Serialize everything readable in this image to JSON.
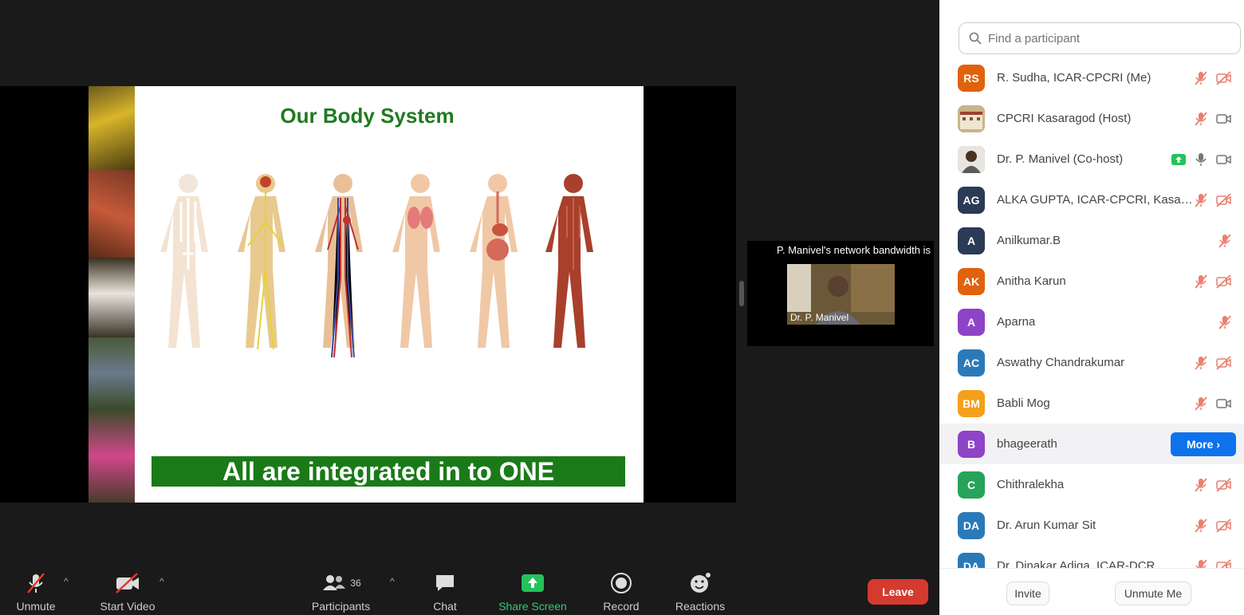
{
  "slide": {
    "title": "Our Body System",
    "banner": "All are integrated in to ONE"
  },
  "thumbnail": {
    "notice": "P. Manivel's network bandwidth is",
    "name": "Dr. P. Manivel"
  },
  "toolbar": {
    "unmute": "Unmute",
    "start_video": "Start Video",
    "participants": "Participants",
    "participant_count": "36",
    "chat": "Chat",
    "share_screen": "Share Screen",
    "record": "Record",
    "reactions": "Reactions",
    "leave": "Leave"
  },
  "panel": {
    "search_placeholder": "Find a participant",
    "invite": "Invite",
    "unmute_me": "Unmute Me",
    "more_label": "More",
    "participants": [
      {
        "initials": "RS",
        "color": "#e0620d",
        "name": "R. Sudha, ICAR-CPCRI (Me)"
      },
      {
        "initials": "",
        "color": "#8a6b3d",
        "name": "CPCRI Kasaragod (Host)"
      },
      {
        "initials": "",
        "color": "#5a4632",
        "name": "Dr. P. Manivel (Co-host)"
      },
      {
        "initials": "AG",
        "color": "#2b3a55",
        "name": "ALKA GUPTA, ICAR-CPCRI, Kasar..."
      },
      {
        "initials": "A",
        "color": "#2b3a55",
        "name": "Anilkumar.B"
      },
      {
        "initials": "AK",
        "color": "#e0620d",
        "name": "Anitha Karun"
      },
      {
        "initials": "A",
        "color": "#8e44c6",
        "name": "Aparna"
      },
      {
        "initials": "AC",
        "color": "#2a7ab9",
        "name": "Aswathy Chandrakumar"
      },
      {
        "initials": "BM",
        "color": "#f5a01a",
        "name": "Babli Mog"
      },
      {
        "initials": "B",
        "color": "#8e44c6",
        "name": "bhageerath"
      },
      {
        "initials": "C",
        "color": "#27a35a",
        "name": "Chithralekha"
      },
      {
        "initials": "DA",
        "color": "#2a7ab9",
        "name": "Dr. Arun Kumar Sit"
      },
      {
        "initials": "DA",
        "color": "#2a7ab9",
        "name": "Dr. Dinakar Adiga, ICAR-DCR"
      }
    ]
  }
}
